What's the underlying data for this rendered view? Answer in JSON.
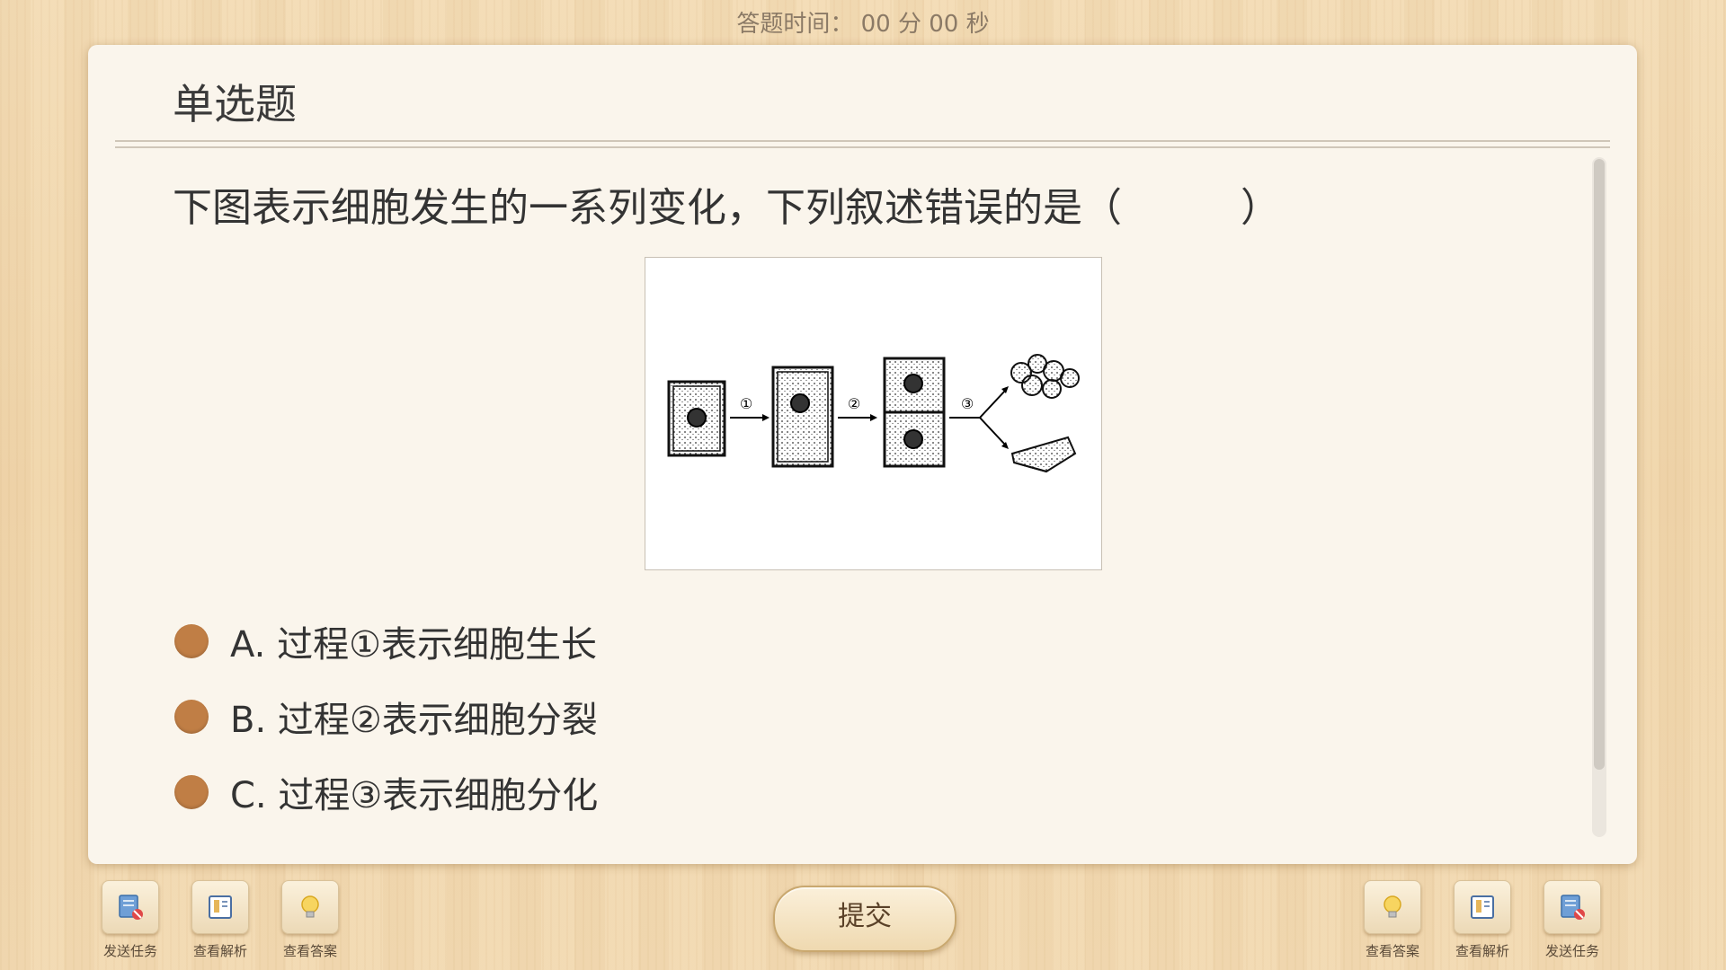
{
  "timer": {
    "text": "答题时间： 00 分 00 秒"
  },
  "card": {
    "title": "单选题",
    "question": "下图表示细胞发生的一系列变化，下列叙述错误的是（　　　）",
    "figure": {
      "step_labels": [
        "①",
        "②",
        "③"
      ]
    },
    "options": [
      {
        "letter": "A.",
        "text": "过程①表示细胞生长"
      },
      {
        "letter": "B.",
        "text": "过程②表示细胞分裂"
      },
      {
        "letter": "C.",
        "text": "过程③表示细胞分化"
      }
    ]
  },
  "toolbar": {
    "left": [
      {
        "label": "发送任务",
        "icon": "send-task-icon"
      },
      {
        "label": "查看解析",
        "icon": "view-analysis-icon"
      },
      {
        "label": "查看答案",
        "icon": "lightbulb-icon"
      }
    ],
    "submit_label": "提交",
    "right": [
      {
        "label": "查看答案",
        "icon": "lightbulb-icon"
      },
      {
        "label": "查看解析",
        "icon": "view-analysis-icon"
      },
      {
        "label": "发送任务",
        "icon": "send-task-icon"
      }
    ]
  },
  "colors": {
    "radio": "#c07e45",
    "card_bg": "#faf5ec",
    "wood": "#f0d6ac"
  }
}
